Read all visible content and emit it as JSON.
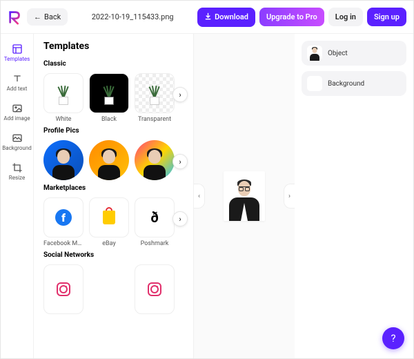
{
  "header": {
    "back_label": "Back",
    "filename": "2022-10-19_115433.png",
    "download_label": "Download",
    "upgrade_label": "Upgrade to Pro",
    "login_label": "Log in",
    "signup_label": "Sign up"
  },
  "rail": {
    "items": [
      {
        "label": "Templates"
      },
      {
        "label": "Add text"
      },
      {
        "label": "Add image"
      },
      {
        "label": "Background"
      },
      {
        "label": "Resize"
      }
    ]
  },
  "panel": {
    "title": "Templates",
    "sections": {
      "classic": {
        "title": "Classic",
        "items": [
          {
            "label": "White"
          },
          {
            "label": "Black"
          },
          {
            "label": "Transparent"
          }
        ]
      },
      "profile_pics": {
        "title": "Profile Pics"
      },
      "marketplaces": {
        "title": "Marketplaces",
        "items": [
          {
            "label": "Facebook Ma..."
          },
          {
            "label": "eBay"
          },
          {
            "label": "Poshmark"
          }
        ]
      },
      "social": {
        "title": "Social Networks"
      }
    }
  },
  "right_panel": {
    "object_label": "Object",
    "background_label": "Background"
  },
  "colors": {
    "primary": "#5b21ff"
  }
}
